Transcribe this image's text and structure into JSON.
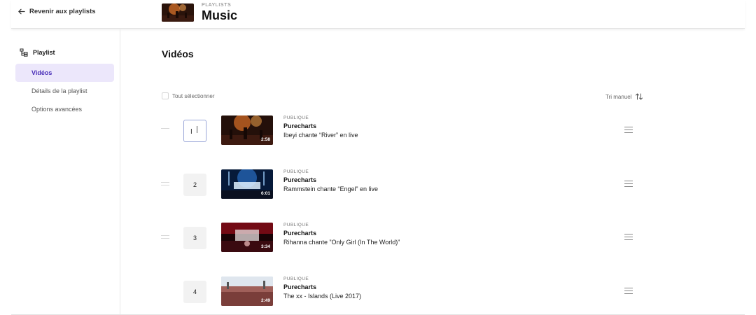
{
  "header": {
    "back_label": "Revenir aux playlists",
    "kicker": "PLAYLISTS",
    "title": "Music"
  },
  "sidebar": {
    "heading": "Playlist",
    "items": [
      {
        "label": "Vidéos",
        "active": true
      },
      {
        "label": "Détails de la playlist",
        "active": false
      },
      {
        "label": "Options avancées",
        "active": false
      }
    ]
  },
  "main": {
    "title": "Vidéos",
    "select_all_label": "Tout sélectionner",
    "sort_label": "Tri manuel",
    "videos": [
      {
        "position": "",
        "visibility": "PUBLIQUE",
        "channel": "Purecharts",
        "title": "Ibeyi chante “River” en live",
        "duration": "2:58",
        "editing": true
      },
      {
        "position": "2",
        "visibility": "PUBLIQUE",
        "channel": "Purecharts",
        "title": "Rammstein chante “Engel” en live",
        "duration": "6:01",
        "editing": false
      },
      {
        "position": "3",
        "visibility": "PUBLIQUE",
        "channel": "Purecharts",
        "title": "Rihanna chante ”Only Girl (In The World)”",
        "duration": "3:34",
        "editing": false
      },
      {
        "position": "4",
        "visibility": "PUBLIQUE",
        "channel": "Purecharts",
        "title": "The xx - Islands (Live 2017)",
        "duration": "2:49",
        "editing": false
      }
    ]
  },
  "colors": {
    "accent": "#4a2fb8",
    "active_bg": "#ece7fb",
    "divider": "#e3e3e3"
  },
  "icons": {
    "back": "arrow-left-icon",
    "playlist": "playlist-tree-icon",
    "sort": "sort-arrows-icon",
    "drag": "drag-handle-icon"
  }
}
